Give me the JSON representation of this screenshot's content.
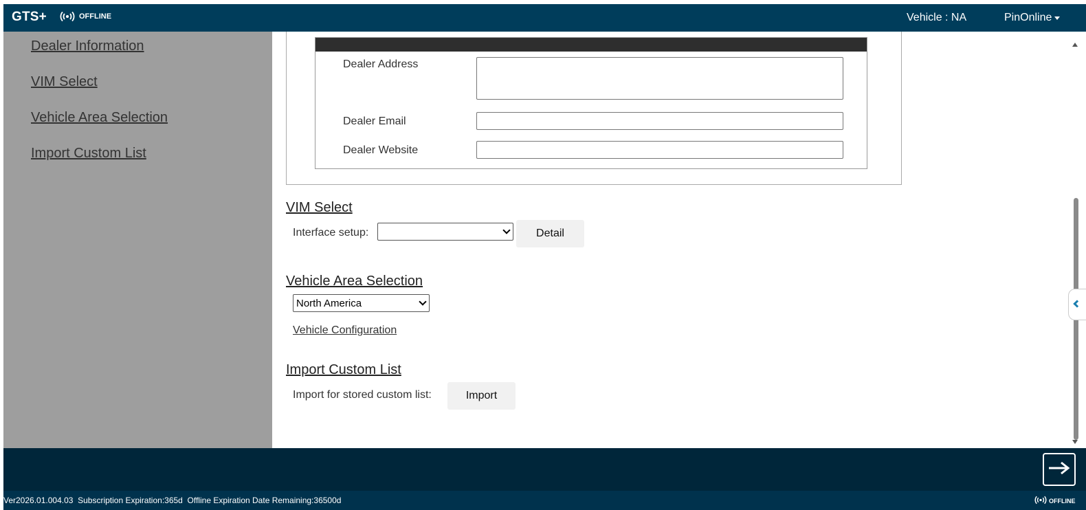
{
  "header": {
    "brand": "GTS+",
    "connection_status": "OFFLINE",
    "vehicle": "Vehicle : NA",
    "user_menu": "PinOnline"
  },
  "sidebar": {
    "items": [
      {
        "label": "Dealer Information"
      },
      {
        "label": "VIM Select"
      },
      {
        "label": "Vehicle Area Selection"
      },
      {
        "label": "Import Custom List"
      }
    ]
  },
  "dealer": {
    "address_label": "Dealer Address",
    "address_value": "",
    "email_label": "Dealer Email",
    "email_value": "",
    "website_label": "Dealer Website",
    "website_value": ""
  },
  "vim": {
    "title": "VIM Select",
    "interface_label": "Interface setup:",
    "interface_value": "",
    "detail_button": "Detail"
  },
  "area": {
    "title": "Vehicle Area Selection",
    "selected_region": "North America",
    "config_link": "Vehicle Configuration"
  },
  "import": {
    "title": "Import Custom List",
    "label": "Import for stored custom list:",
    "button": "Import"
  },
  "status": {
    "text": "Ver2026.01.004.03  Subscription Expiration:365d  Offline Expiration Date Remaining:36500d",
    "connection": "OFFLINE"
  },
  "colors": {
    "header_bg": "#003d5b",
    "sidebar_bg": "#9e9e9e",
    "bottom_bar_bg": "#00263a",
    "status_bg": "#00324d"
  }
}
